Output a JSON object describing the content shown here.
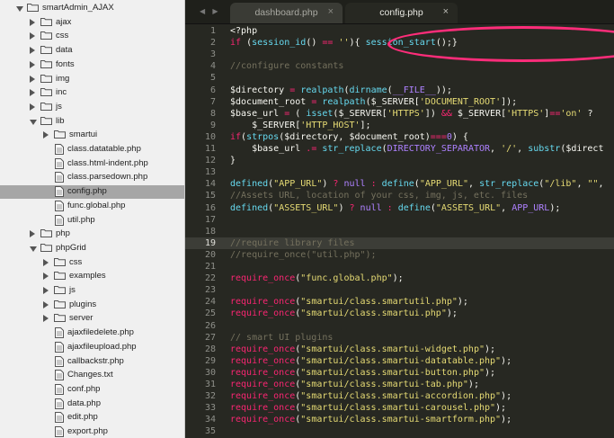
{
  "sidebar": {
    "items": [
      {
        "label": "smartAdmin_AJAX",
        "type": "folder",
        "open": true,
        "indent": 0
      },
      {
        "label": "ajax",
        "type": "folder",
        "open": false,
        "indent": 1
      },
      {
        "label": "css",
        "type": "folder",
        "open": false,
        "indent": 1
      },
      {
        "label": "data",
        "type": "folder",
        "open": false,
        "indent": 1
      },
      {
        "label": "fonts",
        "type": "folder",
        "open": false,
        "indent": 1
      },
      {
        "label": "img",
        "type": "folder",
        "open": false,
        "indent": 1
      },
      {
        "label": "inc",
        "type": "folder",
        "open": false,
        "indent": 1
      },
      {
        "label": "js",
        "type": "folder",
        "open": false,
        "indent": 1
      },
      {
        "label": "lib",
        "type": "folder",
        "open": true,
        "indent": 1
      },
      {
        "label": "smartui",
        "type": "folder",
        "open": false,
        "indent": 2
      },
      {
        "label": "class.datatable.php",
        "type": "file",
        "indent": 2
      },
      {
        "label": "class.html-indent.php",
        "type": "file",
        "indent": 2
      },
      {
        "label": "class.parsedown.php",
        "type": "file",
        "indent": 2
      },
      {
        "label": "config.php",
        "type": "file",
        "indent": 2,
        "selected": true
      },
      {
        "label": "func.global.php",
        "type": "file",
        "indent": 2
      },
      {
        "label": "util.php",
        "type": "file",
        "indent": 2
      },
      {
        "label": "php",
        "type": "folder",
        "open": false,
        "indent": 1
      },
      {
        "label": "phpGrid",
        "type": "folder",
        "open": true,
        "indent": 1
      },
      {
        "label": "css",
        "type": "folder",
        "open": false,
        "indent": 2
      },
      {
        "label": "examples",
        "type": "folder",
        "open": false,
        "indent": 2
      },
      {
        "label": "js",
        "type": "folder",
        "open": false,
        "indent": 2
      },
      {
        "label": "plugins",
        "type": "folder",
        "open": false,
        "indent": 2
      },
      {
        "label": "server",
        "type": "folder",
        "open": false,
        "indent": 2
      },
      {
        "label": "ajaxfiledelete.php",
        "type": "file",
        "indent": 2
      },
      {
        "label": "ajaxfileupload.php",
        "type": "file",
        "indent": 2
      },
      {
        "label": "callbackstr.php",
        "type": "file",
        "indent": 2
      },
      {
        "label": "Changes.txt",
        "type": "file",
        "indent": 2
      },
      {
        "label": "conf.php",
        "type": "file",
        "indent": 2
      },
      {
        "label": "data.php",
        "type": "file",
        "indent": 2
      },
      {
        "label": "edit.php",
        "type": "file",
        "indent": 2
      },
      {
        "label": "export.php",
        "type": "file",
        "indent": 2
      }
    ]
  },
  "editor": {
    "nav": "◀ ▶",
    "tabs": [
      {
        "label": "dashboard.php",
        "close": "×",
        "active": false
      },
      {
        "label": "config.php",
        "close": "×",
        "active": true
      }
    ],
    "current_line": 19,
    "lines": [
      [
        [
          "pl",
          "<?php"
        ]
      ],
      [
        [
          "kw",
          "if"
        ],
        [
          "pl",
          " ("
        ],
        [
          "fn",
          "session_id"
        ],
        [
          "pl",
          "() "
        ],
        [
          "kw",
          "=="
        ],
        [
          "pl",
          " "
        ],
        [
          "st",
          "''"
        ],
        [
          "pl",
          "){ "
        ],
        [
          "fn",
          "session_start"
        ],
        [
          "pl",
          "();}"
        ]
      ],
      [],
      [
        [
          "cm",
          "//configure constants"
        ]
      ],
      [],
      [
        [
          "va",
          "$directory"
        ],
        [
          "pl",
          " "
        ],
        [
          "kw",
          "="
        ],
        [
          "pl",
          " "
        ],
        [
          "fn",
          "realpath"
        ],
        [
          "pl",
          "("
        ],
        [
          "fn",
          "dirname"
        ],
        [
          "pl",
          "("
        ],
        [
          "cn",
          "__FILE__"
        ],
        [
          "pl",
          "));"
        ]
      ],
      [
        [
          "va",
          "$document_root"
        ],
        [
          "pl",
          " "
        ],
        [
          "kw",
          "="
        ],
        [
          "pl",
          " "
        ],
        [
          "fn",
          "realpath"
        ],
        [
          "pl",
          "($_SERVER["
        ],
        [
          "st",
          "'DOCUMENT_ROOT'"
        ],
        [
          "pl",
          "]);"
        ]
      ],
      [
        [
          "va",
          "$base_url"
        ],
        [
          "pl",
          " "
        ],
        [
          "kw",
          "="
        ],
        [
          "pl",
          " ( "
        ],
        [
          "fn",
          "isset"
        ],
        [
          "pl",
          "($_SERVER["
        ],
        [
          "st",
          "'HTTPS'"
        ],
        [
          "pl",
          "]) "
        ],
        [
          "kw",
          "&&"
        ],
        [
          "pl",
          " $_SERVER["
        ],
        [
          "st",
          "'HTTPS'"
        ],
        [
          "pl",
          "]"
        ],
        [
          "kw",
          "=="
        ],
        [
          "st",
          "'on'"
        ],
        [
          "pl",
          " ?"
        ]
      ],
      [
        [
          "pl",
          "    $_SERVER["
        ],
        [
          "st",
          "'HTTP_HOST'"
        ],
        [
          "pl",
          "];"
        ]
      ],
      [
        [
          "kw",
          "if"
        ],
        [
          "pl",
          "("
        ],
        [
          "fn",
          "strpos"
        ],
        [
          "pl",
          "($directory, $document_root)"
        ],
        [
          "kw",
          "==="
        ],
        [
          "cn",
          "0"
        ],
        [
          "pl",
          ") {"
        ]
      ],
      [
        [
          "pl",
          "    $base_url "
        ],
        [
          "kw",
          ".="
        ],
        [
          "pl",
          " "
        ],
        [
          "fn",
          "str_replace"
        ],
        [
          "pl",
          "("
        ],
        [
          "cn",
          "DIRECTORY_SEPARATOR"
        ],
        [
          "pl",
          ", "
        ],
        [
          "st",
          "'/'"
        ],
        [
          "pl",
          ", "
        ],
        [
          "fn",
          "substr"
        ],
        [
          "pl",
          "($direct"
        ]
      ],
      [
        [
          "pl",
          "}"
        ]
      ],
      [],
      [
        [
          "fn",
          "defined"
        ],
        [
          "pl",
          "("
        ],
        [
          "st",
          "\"APP_URL\""
        ],
        [
          "pl",
          ") "
        ],
        [
          "kw",
          "?"
        ],
        [
          "pl",
          " "
        ],
        [
          "cn",
          "null"
        ],
        [
          "pl",
          " "
        ],
        [
          "kw",
          ":"
        ],
        [
          "pl",
          " "
        ],
        [
          "fn",
          "define"
        ],
        [
          "pl",
          "("
        ],
        [
          "st",
          "\"APP_URL\""
        ],
        [
          "pl",
          ", "
        ],
        [
          "fn",
          "str_replace"
        ],
        [
          "pl",
          "("
        ],
        [
          "st",
          "\"/lib\""
        ],
        [
          "pl",
          ", "
        ],
        [
          "st",
          "\"\""
        ],
        [
          "pl",
          ","
        ]
      ],
      [
        [
          "cm",
          "//Assets URL, location of your css, img, js, etc. files"
        ]
      ],
      [
        [
          "fn",
          "defined"
        ],
        [
          "pl",
          "("
        ],
        [
          "st",
          "\"ASSETS_URL\""
        ],
        [
          "pl",
          ") "
        ],
        [
          "kw",
          "?"
        ],
        [
          "pl",
          " "
        ],
        [
          "cn",
          "null"
        ],
        [
          "pl",
          " "
        ],
        [
          "kw",
          ":"
        ],
        [
          "pl",
          " "
        ],
        [
          "fn",
          "define"
        ],
        [
          "pl",
          "("
        ],
        [
          "st",
          "\"ASSETS_URL\""
        ],
        [
          "pl",
          ", "
        ],
        [
          "cn",
          "APP_URL"
        ],
        [
          "pl",
          ");"
        ]
      ],
      [],
      [],
      [
        [
          "cm",
          "//require library files"
        ]
      ],
      [
        [
          "cm",
          "//require_once(\"util.php\");"
        ]
      ],
      [],
      [
        [
          "kw",
          "require_once"
        ],
        [
          "pl",
          "("
        ],
        [
          "st",
          "\"func.global.php\""
        ],
        [
          "pl",
          ");"
        ]
      ],
      [],
      [
        [
          "kw",
          "require_once"
        ],
        [
          "pl",
          "("
        ],
        [
          "st",
          "\"smartui/class.smartutil.php\""
        ],
        [
          "pl",
          ");"
        ]
      ],
      [
        [
          "kw",
          "require_once"
        ],
        [
          "pl",
          "("
        ],
        [
          "st",
          "\"smartui/class.smartui.php\""
        ],
        [
          "pl",
          ");"
        ]
      ],
      [],
      [
        [
          "cm",
          "// smart UI plugins"
        ]
      ],
      [
        [
          "kw",
          "require_once"
        ],
        [
          "pl",
          "("
        ],
        [
          "st",
          "\"smartui/class.smartui-widget.php\""
        ],
        [
          "pl",
          ");"
        ]
      ],
      [
        [
          "kw",
          "require_once"
        ],
        [
          "pl",
          "("
        ],
        [
          "st",
          "\"smartui/class.smartui-datatable.php\""
        ],
        [
          "pl",
          ");"
        ]
      ],
      [
        [
          "kw",
          "require_once"
        ],
        [
          "pl",
          "("
        ],
        [
          "st",
          "\"smartui/class.smartui-button.php\""
        ],
        [
          "pl",
          ");"
        ]
      ],
      [
        [
          "kw",
          "require_once"
        ],
        [
          "pl",
          "("
        ],
        [
          "st",
          "\"smartui/class.smartui-tab.php\""
        ],
        [
          "pl",
          ");"
        ]
      ],
      [
        [
          "kw",
          "require_once"
        ],
        [
          "pl",
          "("
        ],
        [
          "st",
          "\"smartui/class.smartui-accordion.php\""
        ],
        [
          "pl",
          ");"
        ]
      ],
      [
        [
          "kw",
          "require_once"
        ],
        [
          "pl",
          "("
        ],
        [
          "st",
          "\"smartui/class.smartui-carousel.php\""
        ],
        [
          "pl",
          ");"
        ]
      ],
      [
        [
          "kw",
          "require_once"
        ],
        [
          "pl",
          "("
        ],
        [
          "st",
          "\"smartui/class.smartui-smartform.php\""
        ],
        [
          "pl",
          ");"
        ]
      ],
      []
    ]
  },
  "colors": {
    "annotation": "#ff2d7a",
    "keyword": "#f92672",
    "function": "#66d9ef",
    "string": "#e6db74",
    "comment": "#75715e",
    "constant": "#ae81ff"
  }
}
